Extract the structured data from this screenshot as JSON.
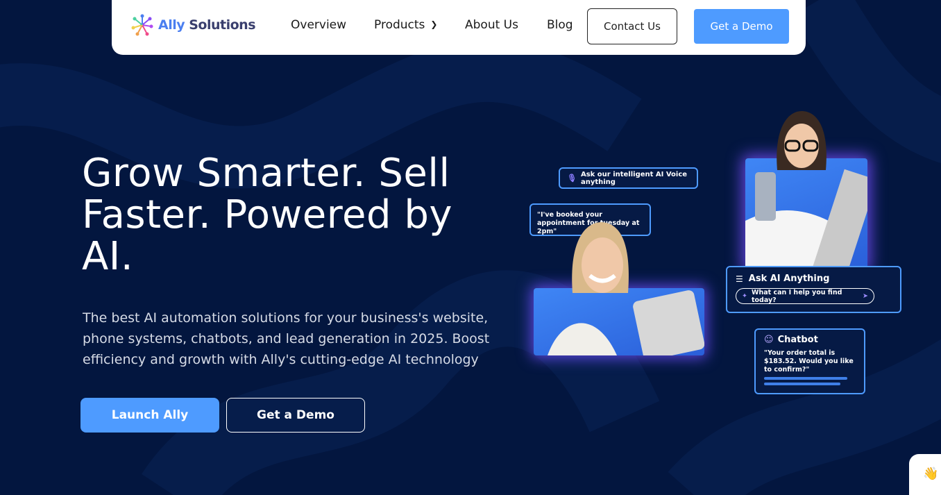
{
  "nav": {
    "logo": {
      "part1": "Ally",
      "part2": "Solutions"
    },
    "links": [
      "Overview",
      "Products",
      "About Us",
      "Blog"
    ],
    "contact_label": "Contact Us",
    "demo_label": "Get a Demo"
  },
  "hero": {
    "title": "Grow Smarter. Sell Faster. Powered by AI.",
    "subtitle": "The best AI automation solutions for your business's website, phone systems, chatbots, and lead generation in 2025. Boost efficiency and growth with Ally's cutting-edge AI technology",
    "launch_label": "Launch Ally",
    "demo_label": "Get a Demo"
  },
  "illustration": {
    "voice_card": "Ask our intelligent AI Voice anything",
    "booked_card": "\"I've booked your appointment for tuesday at 2pm\"",
    "ask_title": "Ask AI Anything",
    "ask_placeholder": "What can I help you find today?",
    "chat_title": "Chatbot",
    "chat_msg": "\"Your order total is $183.52. Would you like to confirm?\""
  },
  "widget": {
    "icon": "👋"
  },
  "colors": {
    "background": "#03163f",
    "accent": "#4e9bff",
    "glow": "#7a4dff"
  }
}
